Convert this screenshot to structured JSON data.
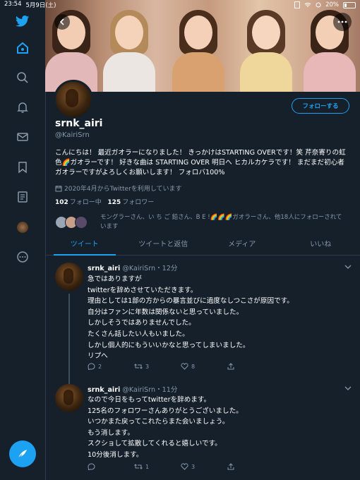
{
  "status_bar": {
    "time": "23:54",
    "date": "5月9日(土)",
    "battery": "20%"
  },
  "profile": {
    "name": "srnk_airi",
    "handle": "@KairiSrn",
    "follow_button": "フォローする",
    "bio": "こんにちは！ 最近ガオラーになりました！ きっかけはSTARTING OVERです！笑 芹奈寄りの虹色🌈ガオラーです！ 好きな曲は STARTING OVER 明日へ ヒカルカケラです！ まだまだ初心者ガオラーですがよろしくお願いします！ フォロバ100%",
    "joined": "2020年4月からTwitterを利用しています",
    "following_count": "102",
    "following_label": "フォロー中",
    "followers_count": "125",
    "followers_label": "フォロワー",
    "followed_by": "モングラーさん、い ち ご 鉛さん、B E !🌈🌈🌈ガオラーさん、他18人にフォローされています"
  },
  "tabs": [
    {
      "label": "ツイート",
      "active": true
    },
    {
      "label": "ツイートと返信",
      "active": false
    },
    {
      "label": "メディア",
      "active": false
    },
    {
      "label": "いいね",
      "active": false
    }
  ],
  "tweets": [
    {
      "name": "srnk_airi",
      "handle": "@KairiSrn",
      "time": "・12分",
      "lines": [
        "急ではありますが",
        "twitterを辞めさせていただきます。",
        "理由としては1部の方からの暴言並びに過度なしつこさが原因です。",
        "自分はファンに年数は関係ないと思っていました。",
        "しかしそうではありませんでした。",
        "たくさん話したい人もいました。",
        "しかし個人的にもういいかなと思ってしまいました。",
        "リプへ"
      ],
      "replies": "2",
      "retweets": "3",
      "likes": "8"
    },
    {
      "name": "srnk_airi",
      "handle": "@KairiSrn",
      "time": "・11分",
      "lines": [
        "なので今日をもってtwitterを辞めます。",
        "125名のフォロワーさんありがとうございました。",
        "いつかまた戻ってこれたらまた会いましょう。",
        "もう消します。",
        "スクショして拡散してくれると嬉しいです。",
        "10分後消します。"
      ],
      "replies": "",
      "retweets": "1",
      "likes": "3"
    }
  ],
  "colors": {
    "accent": "#1da1f2",
    "background": "#15202b",
    "muted": "#8899a6",
    "border": "#2f3b47"
  }
}
